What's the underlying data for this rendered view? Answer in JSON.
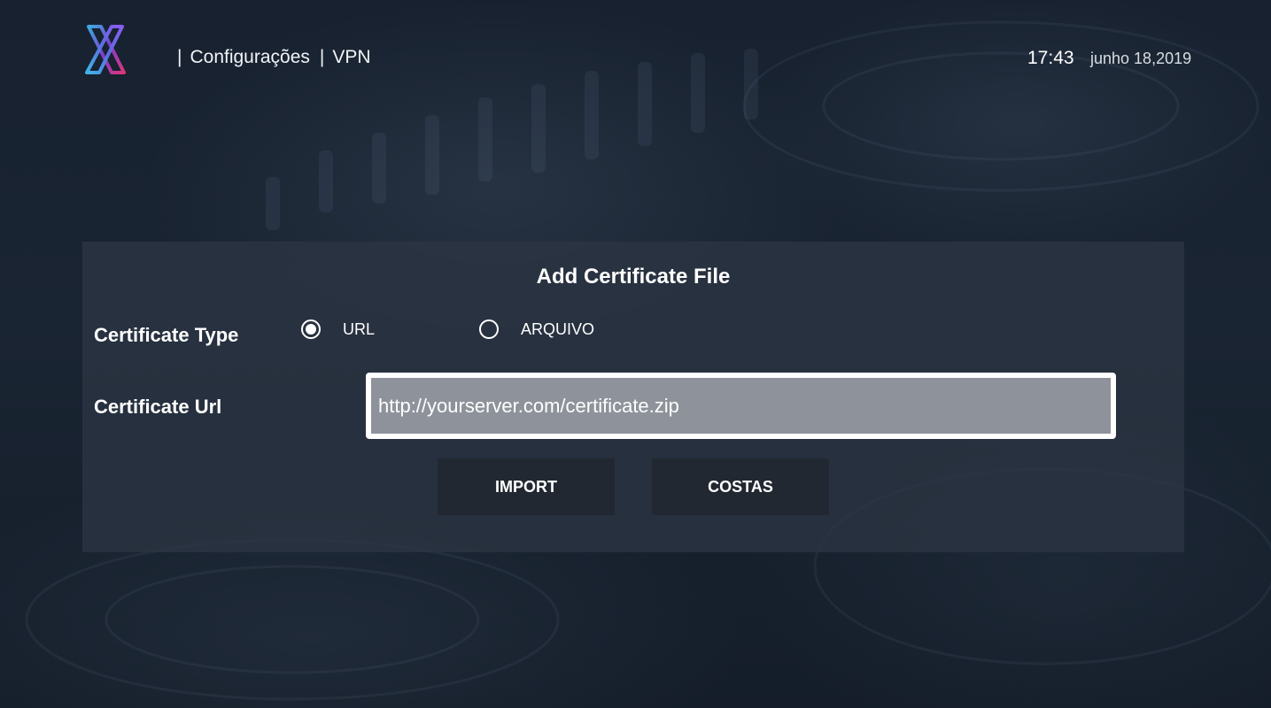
{
  "header": {
    "breadcrumb_separator": "|",
    "section": "Configurações",
    "page": "VPN",
    "time": "17:43",
    "date": "junho 18,2019"
  },
  "dialog": {
    "title": "Add Certificate File",
    "certificate_type_label": "Certificate Type",
    "options": [
      {
        "label": "URL",
        "selected": true
      },
      {
        "label": "ARQUIVO",
        "selected": false
      }
    ],
    "certificate_url_label": "Certificate Url",
    "certificate_url_value": "http://yourserver.com/certificate.zip",
    "import_button": "IMPORT",
    "back_button": "COSTAS"
  },
  "icons": {
    "logo": "x-logo-icon",
    "radio_selected": "radio-selected-icon",
    "radio_unselected": "radio-unselected-icon"
  },
  "colors": {
    "logo_gradient": [
      "#3fa9e0",
      "#7a3fd0",
      "#e0347a"
    ],
    "dialog_background": "#2c3542",
    "input_background": "#8e939b",
    "input_border": "#ffffff",
    "button_background": "#222830"
  }
}
